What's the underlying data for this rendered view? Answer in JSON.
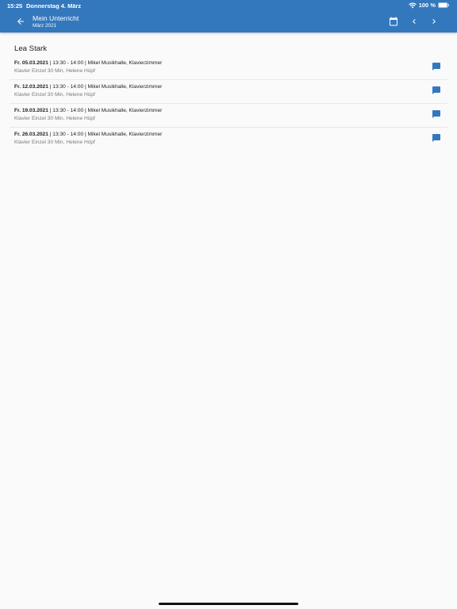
{
  "status_bar": {
    "time": "15:25",
    "date": "Donnerstag 4. März",
    "battery_percent": "100 %"
  },
  "header": {
    "title": "Mein Unterricht",
    "subtitle": "März 2021"
  },
  "icons": {
    "back": "arrow-left-icon",
    "calendar": "calendar-icon",
    "prev": "chevron-left-icon",
    "next": "chevron-right-icon",
    "comment": "comment-icon"
  },
  "colors": {
    "appbar": "#3378bd",
    "accent": "#3378bd",
    "background": "#fafafa"
  },
  "student": {
    "name": "Lea Stark"
  },
  "lessons": [
    {
      "date": "Fr. 05.03.2021",
      "details": " | 13:30 - 14:00 | Mikel Musikhalle, Klavierzimmer",
      "subtitle": "Klavier Einzel 30 Min, Helene Hüpf"
    },
    {
      "date": "Fr. 12.03.2021",
      "details": " | 13:30 - 14:00 | Mikel Musikhalle, Klavierzimmer",
      "subtitle": "Klavier Einzel 30 Min, Helene Hüpf"
    },
    {
      "date": "Fr. 19.03.2021",
      "details": " | 13:30 - 14:00 | Mikel Musikhalle, Klavierzimmer",
      "subtitle": "Klavier Einzel 30 Min, Helene Hüpf"
    },
    {
      "date": "Fr. 26.03.2021",
      "details": " | 13:30 - 14:00 | Mikel Musikhalle, Klavierzimmer",
      "subtitle": "Klavier Einzel 30 Min, Helene Hüpf"
    }
  ]
}
